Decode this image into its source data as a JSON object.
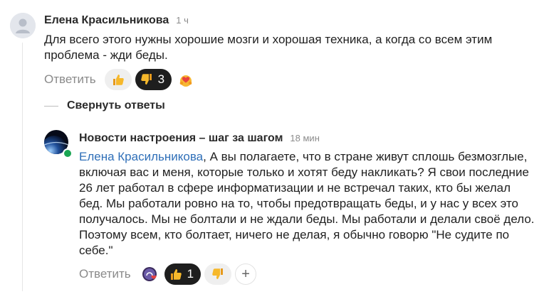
{
  "comment": {
    "author": "Елена Красильникова",
    "time": "1 ч",
    "text": "Для всего этого нужны хорошие мозги и хорошая техника, а когда со всем этим проблема - жди беды.",
    "reply_label": "Ответить",
    "reactions": [
      {
        "icon": "thumbs-up-icon",
        "count": ""
      },
      {
        "icon": "thumbs-down-icon",
        "count": "3",
        "selected": true
      },
      {
        "icon": "heart-hug-icon",
        "count": ""
      }
    ]
  },
  "collapse_label": "Свернуть ответы",
  "reply": {
    "author": "Новости настроения – шаг за шагом",
    "time": "18 мин",
    "mention": "Елена Красильникова",
    "text": ", А вы полагаете, что в стране живут сплошь безмозглые, включая вас и меня, которые только и хотят беду накликать? Я свои последние 26 лет работал в сфере информатизации и не встречал таких, кто бы желал бед. Мы работали ровно на то, чтобы предотвращать беды, и у нас у всех это получалось. Мы не болтали и не ждали беды. Мы работали и делали своё дело. Поэтому всем, кто болтает, ничего не делая, я обычно говорю \"Не судите по себе.\"",
    "reply_label": "Ответить",
    "reactions": [
      {
        "icon": "heart-fire-icon",
        "count": ""
      },
      {
        "icon": "thumbs-up-icon",
        "count": "1",
        "selected": true
      },
      {
        "icon": "thumbs-down-icon",
        "count": ""
      },
      {
        "icon": "plus-icon",
        "count": ""
      }
    ],
    "plus_label": "+"
  },
  "colors": {
    "accent_link": "#2f6fb8",
    "selected_pill": "#1e1e1e",
    "online": "#1aa553"
  }
}
